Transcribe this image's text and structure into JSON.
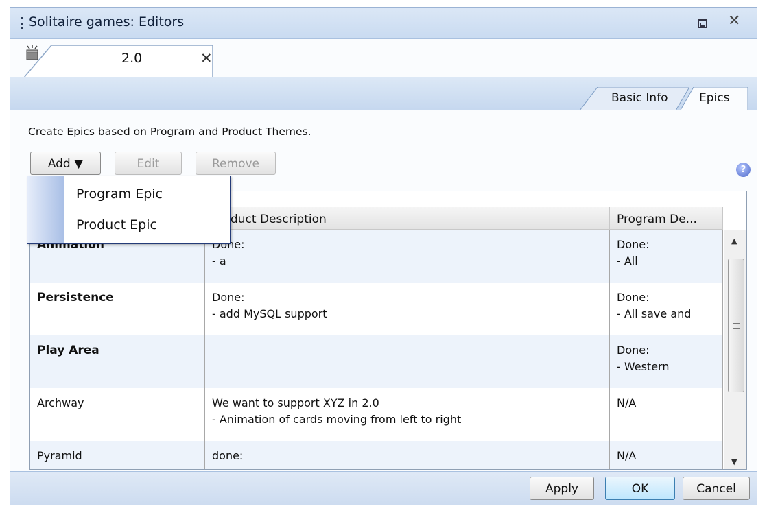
{
  "window": {
    "title": "Solitaire games: Editors",
    "editor_tab": {
      "label": "2.0",
      "icon": "release-box-icon"
    }
  },
  "subtabs": {
    "basic_info": "Basic Info",
    "epics": "Epics",
    "active": "Epics"
  },
  "description": "Create Epics based on Program and Product Themes.",
  "toolbar": {
    "add": "Add ▼",
    "edit": "Edit",
    "remove": "Remove"
  },
  "add_menu": {
    "items": [
      "Program Epic",
      "Product Epic"
    ]
  },
  "table": {
    "columns": [
      "",
      "Product Description",
      "Program De..."
    ],
    "rows": [
      {
        "name": "Animation",
        "bold": true,
        "product": "Done:\n- a",
        "program": "Done:\n- All"
      },
      {
        "name": "Persistence",
        "bold": true,
        "product": "Done:\n- add MySQL support",
        "program": "Done:\n- All save and"
      },
      {
        "name": "Play Area",
        "bold": true,
        "product": "",
        "program": "Done:\n- Western"
      },
      {
        "name": "Archway",
        "bold": false,
        "product": "We want to support XYZ in 2.0\n- Animation of cards moving from left to right",
        "program": "N/A"
      },
      {
        "name": "Pyramid",
        "bold": false,
        "product": "done:",
        "program": "N/A"
      }
    ]
  },
  "footer": {
    "apply": "Apply",
    "ok": "OK",
    "cancel": "Cancel"
  },
  "colors": {
    "header": "#c9dbf1",
    "selection_border": "#243b78",
    "row_alt": "#edf3fb"
  }
}
